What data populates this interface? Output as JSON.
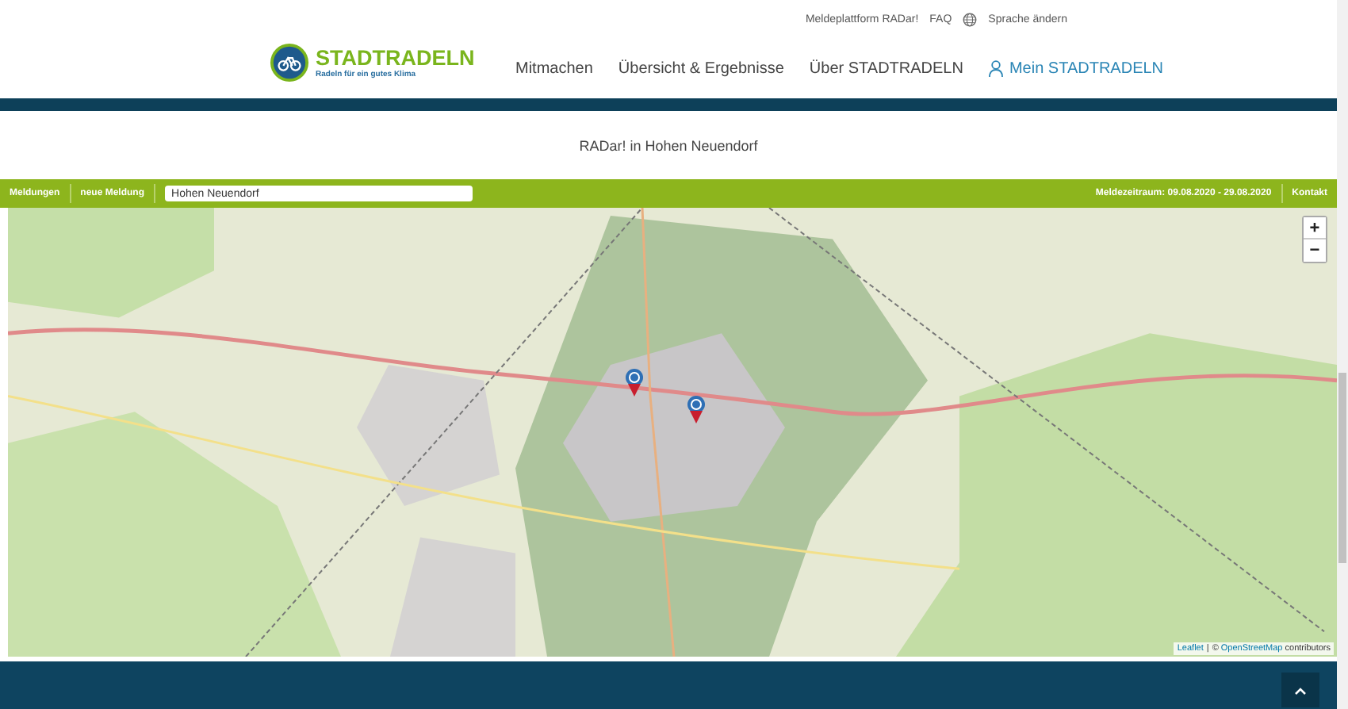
{
  "top_links": [
    "Meldeplattform RADar!",
    "FAQ",
    "Sprache ändern"
  ],
  "logo": {
    "title": "STADTRADELN",
    "tagline": "Radeln für ein gutes Klima"
  },
  "nav": [
    {
      "label": "Mitmachen",
      "kind": "plain"
    },
    {
      "label": "Übersicht & Ergebnisse",
      "kind": "plain"
    },
    {
      "label": "Über STADTRADELN",
      "kind": "plain"
    },
    {
      "label": "Mein STADTRADELN",
      "kind": "account"
    }
  ],
  "page_title": "RADar! in Hohen Neuendorf",
  "toolbar": {
    "left": [
      "Meldungen",
      "neue Meldung"
    ],
    "search": {
      "value": "Hohen Neuendorf"
    },
    "period": "Meldezeitraum: 09.08.2020 - 29.08.2020",
    "contact": "Kontakt"
  },
  "map": {
    "zoom_in": "+",
    "zoom_out": "−",
    "attribution_link": "Leaflet",
    "attribution_sep": "|",
    "attribution_text": "© ",
    "attribution_osm": "OpenStreetMap",
    "attribution_tail": " contributors"
  }
}
